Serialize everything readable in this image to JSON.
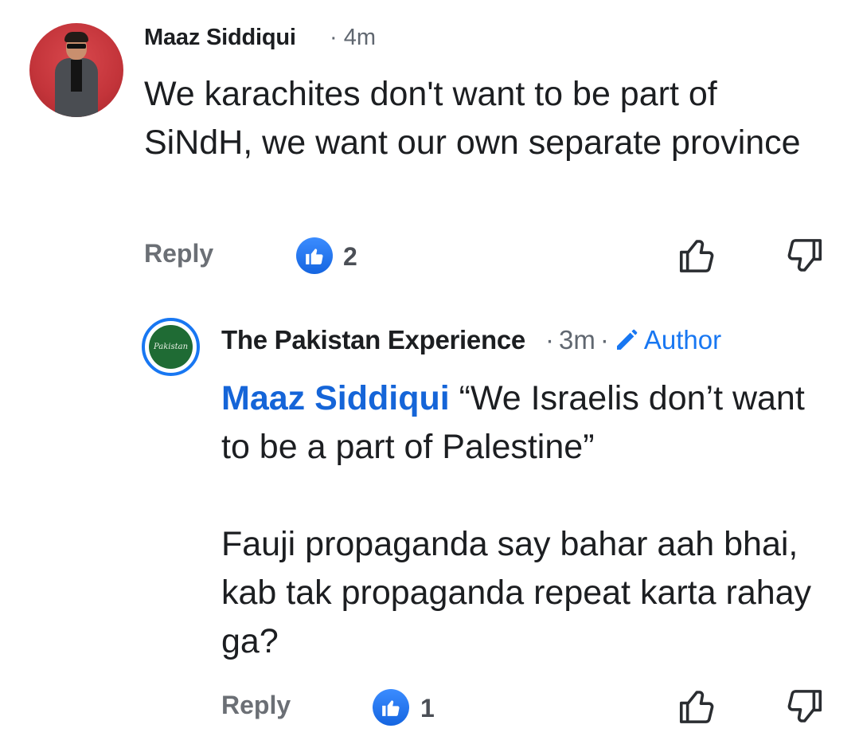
{
  "comments": [
    {
      "author": "Maaz Siddiqui",
      "time": "4m",
      "text": "We karachites don't want to be part of SiNdH, we want our own separate province",
      "reply_label": "Reply",
      "like_count": "2"
    },
    {
      "author": "The Pakistan Experience",
      "time": "3m",
      "badge": "Author",
      "avatar_text": "Pakistan",
      "mention": "Maaz Siddiqui",
      "text_line1": "“We Israelis don’t want to be a part of Palestine”",
      "text_line2": "Fauji propaganda say bahar aah bhai, kab tak propaganda repeat karta rahay ga?",
      "reply_label": "Reply",
      "like_count": "1"
    }
  ],
  "icons": {
    "like_badge": "thumbs-up-icon",
    "like_action": "like-outline-icon",
    "dislike_action": "dislike-outline-icon",
    "author_badge": "pencil-icon"
  },
  "colors": {
    "accent": "#1877f2",
    "mention": "#1565d8",
    "meta": "#606770"
  }
}
